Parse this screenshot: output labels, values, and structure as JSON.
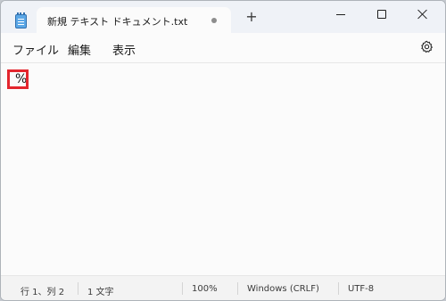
{
  "window": {
    "tab_title": "新規 テキスト ドキュメント.txt",
    "new_tab_label": "+"
  },
  "menu": {
    "items": [
      "ファイル",
      "編集",
      "表示"
    ]
  },
  "editor": {
    "content": "%"
  },
  "status": {
    "position": "行 1、列 2",
    "char_count": "1 文字",
    "zoom": "100%",
    "line_ending": "Windows (CRLF)",
    "encoding": "UTF-8"
  },
  "icons": {
    "app": "notepad-icon",
    "tab_modified": "unsaved-dot-icon",
    "minimize": "minimize-icon",
    "maximize": "maximize-icon",
    "close": "close-icon",
    "settings": "gear-icon"
  },
  "colors": {
    "highlight": "#e3262e",
    "titlebar": "#eff2f7",
    "editor_bg": "#fbfbfb"
  }
}
